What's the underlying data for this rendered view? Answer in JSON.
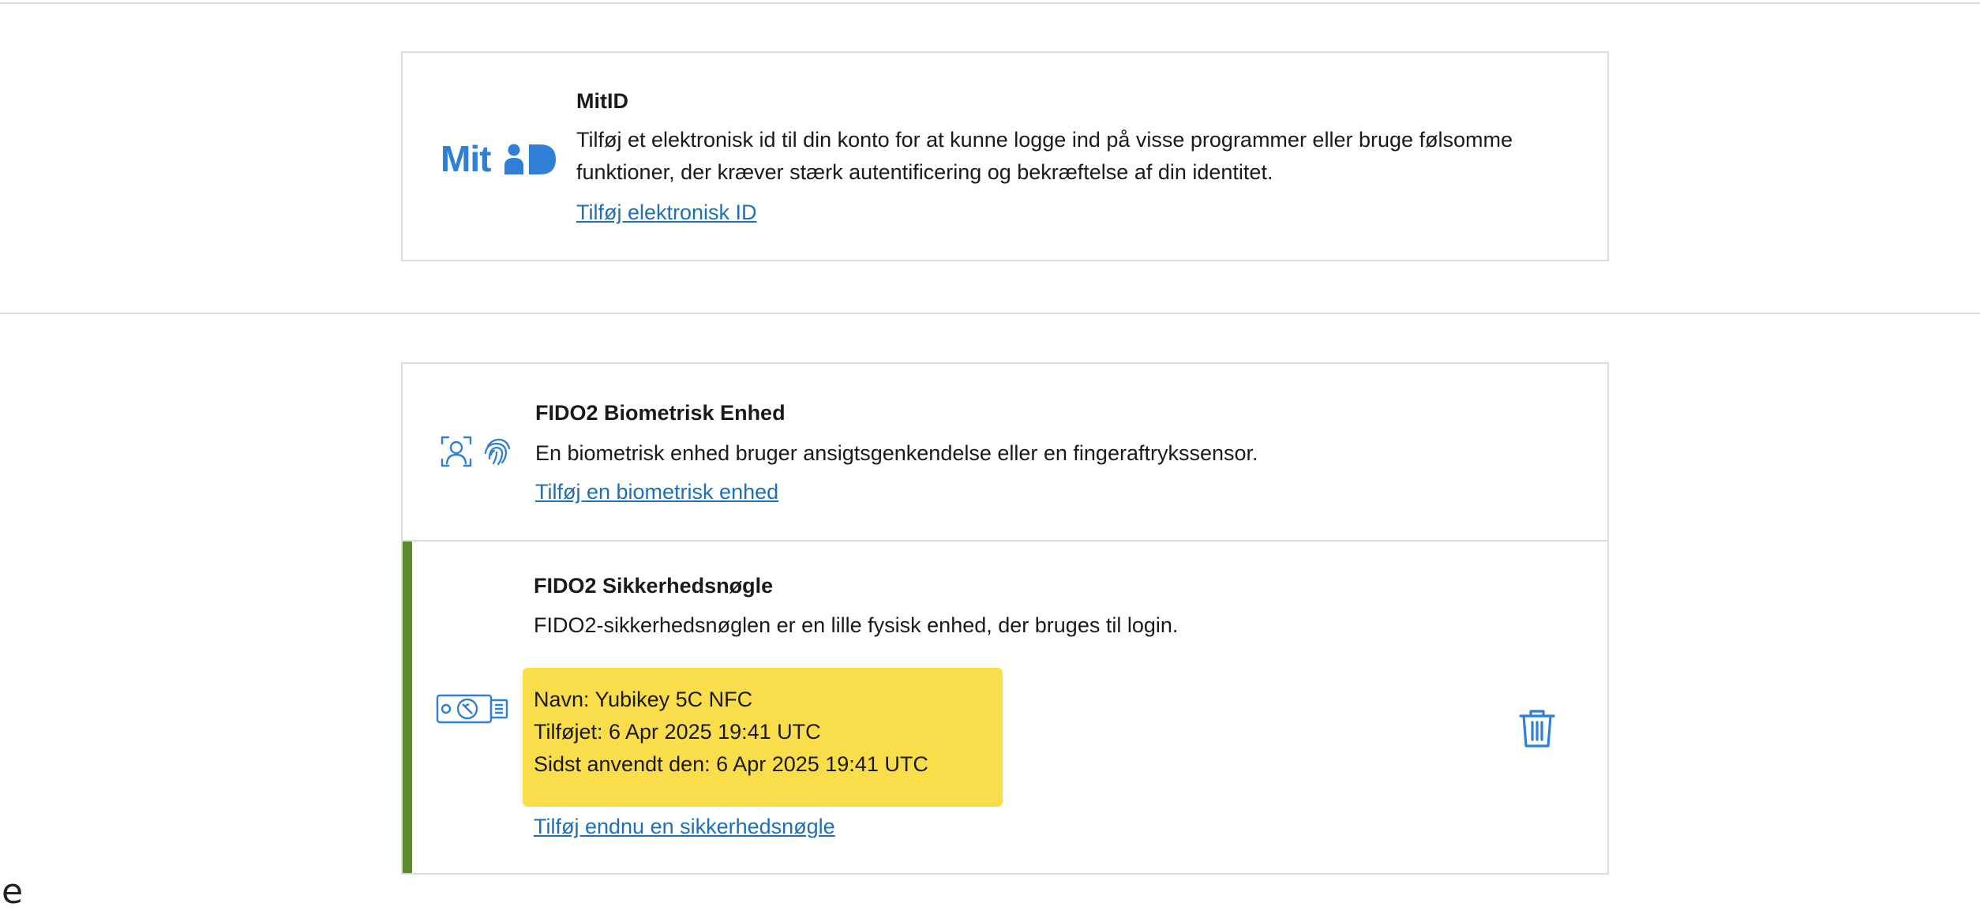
{
  "mitid": {
    "logo_text": "Mit",
    "title": "MitID",
    "description": "Tilføj et elektronisk id til din konto for at kunne logge ind på visse programmer eller bruge følsomme funktioner, der kræver stærk autentificering og bekræftelse af din identitet.",
    "link_label": "Tilføj elektronisk ID"
  },
  "fido2_biometric": {
    "icons": [
      "face-scan-icon",
      "fingerprint-icon"
    ],
    "title": "FIDO2 Biometrisk Enhed",
    "description": "En biometrisk enhed bruger ansigtsgenkendelse eller en fingeraftrykssensor.",
    "link_label": "Tilføj en biometrisk enhed"
  },
  "fido2_security_key": {
    "icon": "security-key-icon",
    "title": "FIDO2 Sikkerhedsnøgle",
    "description": "FIDO2-sikkerhedsnøglen er en lille fysisk enhed, der bruges til login.",
    "registered_key": {
      "name": "Navn: Yubikey 5C NFC",
      "added": "Tilføjet: 6 Apr 2025 19:41 UTC",
      "last_used": "Sidst anvendt den: 6 Apr 2025 19:41 UTC"
    },
    "delete_icon": "trash-icon",
    "link_label": "Tilføj endnu en sikkerhedsnøgle"
  },
  "corner_fragment": "e",
  "colors": {
    "accent_blue": "#2f7fd6",
    "link_blue": "#1f6fb5",
    "active_green": "#5b8a2a",
    "highlight_yellow": "#f9dd4a",
    "border_gray": "#dcdcdc"
  }
}
